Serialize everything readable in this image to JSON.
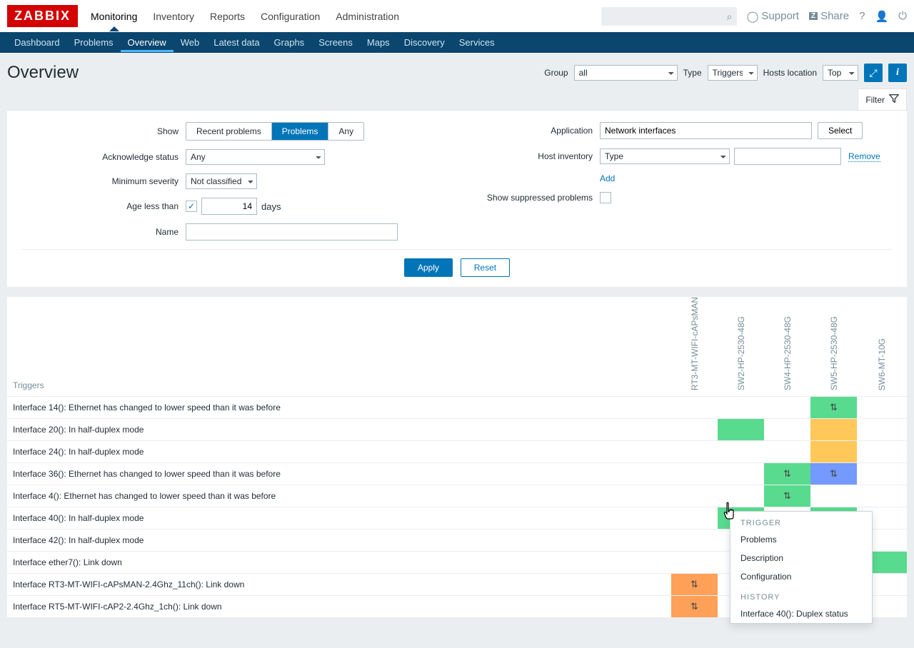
{
  "logo": "ZABBIX",
  "topnav": [
    "Monitoring",
    "Inventory",
    "Reports",
    "Configuration",
    "Administration"
  ],
  "topnav_active": 0,
  "subnav": [
    "Dashboard",
    "Problems",
    "Overview",
    "Web",
    "Latest data",
    "Graphs",
    "Screens",
    "Maps",
    "Discovery",
    "Services"
  ],
  "subnav_active": 2,
  "page_title": "Overview",
  "support": "Support",
  "share": "Share",
  "header_controls": {
    "group_label": "Group",
    "group_value": "all",
    "type_label": "Type",
    "type_value": "Triggers",
    "hosts_loc_label": "Hosts location",
    "hosts_loc_value": "Top"
  },
  "filter_tab": "Filter",
  "filter": {
    "show_label": "Show",
    "show_opts": [
      "Recent problems",
      "Problems",
      "Any"
    ],
    "show_active": 1,
    "ack_label": "Acknowledge status",
    "ack_value": "Any",
    "sev_label": "Minimum severity",
    "sev_value": "Not classified",
    "age_label": "Age less than",
    "age_checked": true,
    "age_value": "14",
    "age_unit": "days",
    "name_label": "Name",
    "name_value": "",
    "app_label": "Application",
    "app_value": "Network interfaces",
    "select": "Select",
    "inv_label": "Host inventory",
    "inv_type": "Type",
    "inv_value": "",
    "remove": "Remove",
    "add": "Add",
    "supp_label": "Show suppressed problems",
    "supp_checked": false,
    "apply": "Apply",
    "reset": "Reset"
  },
  "table": {
    "triggers_header": "Triggers",
    "hosts": [
      "RT3-MT-WIFI-cAPsMAN",
      "SW2-HP-2530-48G",
      "SW4-HP-2530-48G",
      "SW5-HP-2530-48G",
      "SW6-MT-10G"
    ],
    "rows": [
      {
        "name": "Interface 14(): Ethernet has changed to lower speed than it was before",
        "cells": [
          "",
          "",
          "",
          "green-glyph",
          ""
        ]
      },
      {
        "name": "Interface 20(): In half-duplex mode",
        "cells": [
          "",
          "green",
          "",
          "yellow",
          ""
        ]
      },
      {
        "name": "Interface 24(): In half-duplex mode",
        "cells": [
          "",
          "",
          "",
          "yellow",
          ""
        ]
      },
      {
        "name": "Interface 36(): Ethernet has changed to lower speed than it was before",
        "cells": [
          "",
          "",
          "green-glyph",
          "blue-glyph",
          ""
        ]
      },
      {
        "name": "Interface 4(): Ethernet has changed to lower speed than it was before",
        "cells": [
          "",
          "",
          "green-glyph",
          "",
          ""
        ]
      },
      {
        "name": "Interface 40(): In half-duplex mode",
        "cells": [
          "",
          "green",
          "",
          "green",
          ""
        ]
      },
      {
        "name": "Interface 42(): In half-duplex mode",
        "cells": [
          "",
          "",
          "",
          "",
          ""
        ]
      },
      {
        "name": "Interface ether7(): Link down",
        "cells": [
          "",
          "",
          "",
          "",
          "green"
        ]
      },
      {
        "name": "Interface RT3-MT-WIFI-cAPsMAN-2.4Ghz_11ch(): Link down",
        "cells": [
          "orange-glyph",
          "",
          "",
          "",
          ""
        ]
      },
      {
        "name": "Interface RT5-MT-WIFI-cAP2-2.4Ghz_1ch(): Link down",
        "cells": [
          "orange-glyph",
          "",
          "",
          "",
          ""
        ]
      }
    ]
  },
  "popup": {
    "sec1": "TRIGGER",
    "items1": [
      "Problems",
      "Description",
      "Configuration"
    ],
    "sec2": "HISTORY",
    "items2": [
      "Interface 40(): Duplex status"
    ]
  }
}
